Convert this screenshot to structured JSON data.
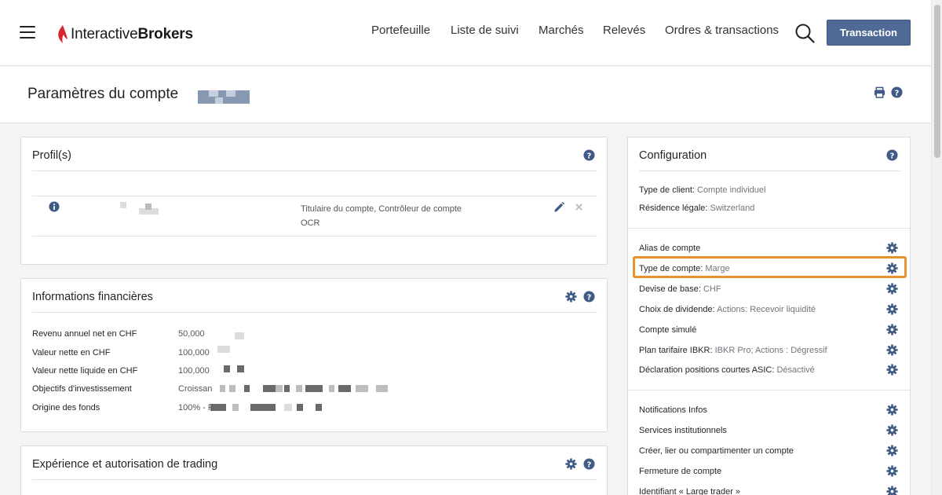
{
  "header": {
    "logo_light": "Interactive",
    "logo_bold": "Brokers",
    "nav": [
      "Portefeuille",
      "Liste de suivi",
      "Marchés",
      "Relevés",
      "Ordres & transactions"
    ],
    "trade_button": "Transaction"
  },
  "page": {
    "title": "Paramètres du compte"
  },
  "profiles": {
    "title": "Profil(s)",
    "role_line1": "Titulaire du compte, Contrôleur de compte",
    "role_line2": "OCR"
  },
  "financial": {
    "title": "Informations financières",
    "rows": [
      {
        "label": "Revenu annuel net en CHF",
        "value": "50,000"
      },
      {
        "label": "Valeur nette en CHF",
        "value": "100,000"
      },
      {
        "label": "Valeur nette liquide en CHF",
        "value": "100,000"
      },
      {
        "label": "Objectifs d'investissement",
        "value": "Croissan"
      },
      {
        "label": "Origine des fonds",
        "value": "100% - R"
      }
    ]
  },
  "experience": {
    "title": "Expérience et autorisation de trading"
  },
  "configuration": {
    "title": "Configuration",
    "info": [
      {
        "label": "Type de client:",
        "value": "Compte individuel"
      },
      {
        "label": "Résidence légale:",
        "value": "Switzerland"
      }
    ],
    "settings": [
      {
        "label": "Alias de compte",
        "value": ""
      },
      {
        "label": "Type de compte:",
        "value": "Marge"
      },
      {
        "label": "Devise de base:",
        "value": "CHF"
      },
      {
        "label": "Choix de dividende:",
        "value": "Actions: Recevoir liquidité"
      },
      {
        "label": "Compte simulé",
        "value": ""
      },
      {
        "label": "Plan tarifaire IBKR:",
        "value": "IBKR Pro; Actions : Dégressif"
      },
      {
        "label": "Déclaration positions courtes ASIC:",
        "value": "Désactivé"
      }
    ],
    "services": [
      "Notifications Infos",
      "Services institutionnels",
      "Créer, lier ou compartimenter un compte",
      "Fermeture de compte",
      "Identifiant « Large trader »"
    ]
  },
  "colors": {
    "accent": "#4f6a95",
    "icon": "#3f5b86",
    "highlight": "#e8912d",
    "logo_red": "#d8262f"
  }
}
